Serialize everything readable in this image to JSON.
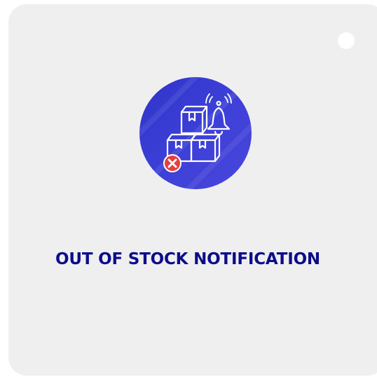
{
  "card": {
    "title": "OUT OF STOCK NOTIFICATION",
    "icon_name": "out-of-stock-notification-icon",
    "badge_icon_name": "error-x-icon"
  },
  "colors": {
    "card_background": "#efeff0",
    "circle_gradient_start": "#2f33c8",
    "circle_gradient_end": "#4a46dc",
    "title": "#0c0d8a",
    "badge": "#e5403f",
    "line_art": "#ffffff"
  }
}
